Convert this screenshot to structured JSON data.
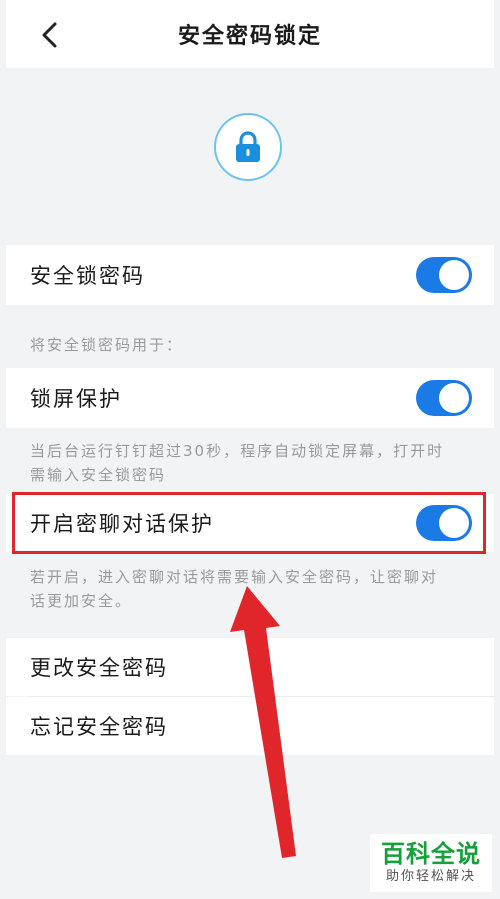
{
  "header": {
    "title": "安全密码锁定"
  },
  "icons": {
    "back": "chevron-left-icon",
    "lock": "lock-icon"
  },
  "colors": {
    "accent": "#1a7ae6",
    "highlight_border": "#e0262b",
    "arrow": "#e0262b"
  },
  "settings": {
    "safe_lock": {
      "label": "安全锁密码",
      "enabled": true
    },
    "section_hint": "将安全锁密码用于：",
    "screen_lock": {
      "label": "锁屏保护",
      "enabled": true,
      "description_line1": "当后台运行钉钉超过30秒，程序自动锁定屏幕，打开时",
      "description_line2": "需输入安全锁密码"
    },
    "secret_chat": {
      "label": "开启密聊对话保护",
      "enabled": true,
      "description_line1": "若开启，进入密聊对话将需要输入安全密码，让密聊对",
      "description_line2": "话更加安全。"
    }
  },
  "actions": {
    "change_password": "更改安全密码",
    "forgot_password": "忘记安全密码"
  },
  "watermark": {
    "title": "百科全说",
    "subtitle": "助你轻松解决"
  }
}
